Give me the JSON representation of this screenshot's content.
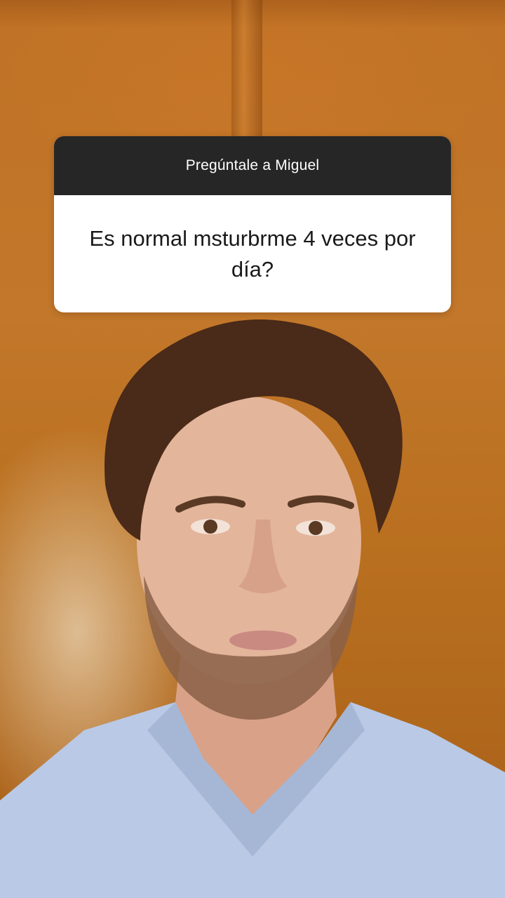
{
  "question_sticker": {
    "title": "Pregúntale a Miguel",
    "question": "Es normal msturbrme 4 veces por día?"
  },
  "colors": {
    "background_wood": "#c07225",
    "card_header": "#262626",
    "card_body": "#ffffff",
    "scrubs": "#b9c9e6"
  }
}
